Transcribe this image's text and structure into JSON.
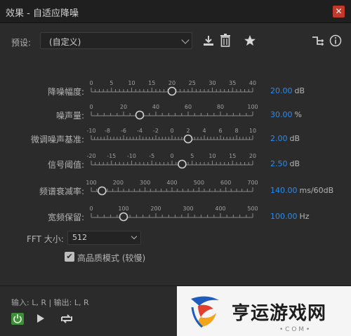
{
  "window": {
    "title": "效果 - 自适应降噪",
    "close_glyph": "✕"
  },
  "toolbar": {
    "preset_label": "预设:",
    "preset_value": "(自定义)",
    "icons": [
      "download-icon",
      "trash-icon",
      "star-icon",
      "routing-icon",
      "info-icon"
    ]
  },
  "sliders": [
    {
      "label": "降噪幅度:",
      "ticks": [
        "0",
        "5",
        "10",
        "15",
        "20",
        "25",
        "30",
        "35",
        "40"
      ],
      "min": 0,
      "max": 40,
      "value": 20,
      "value_text": "20.00",
      "unit": "dB"
    },
    {
      "label": "噪声量:",
      "ticks": [
        "0",
        "20",
        "40",
        "60",
        "80",
        "100"
      ],
      "min": 0,
      "max": 100,
      "value": 30,
      "value_text": "30.00",
      "unit": "%"
    },
    {
      "label": "微调噪声基准:",
      "ticks": [
        "-10",
        "-8",
        "-6",
        "-4",
        "-2",
        "0",
        "2",
        "4",
        "6",
        "8",
        "10"
      ],
      "min": -10,
      "max": 10,
      "value": 2,
      "value_text": "2.00",
      "unit": "dB"
    },
    {
      "label": "信号阈值:",
      "ticks": [
        "-20",
        "-15",
        "-10",
        "-5",
        "0",
        "5",
        "10",
        "15",
        "20"
      ],
      "min": -20,
      "max": 20,
      "value": 2.5,
      "value_text": "2.50",
      "unit": "dB"
    },
    {
      "label": "频谱衰减率:",
      "ticks": [
        "100",
        "200",
        "300",
        "400",
        "500",
        "600",
        "700"
      ],
      "min": 100,
      "max": 700,
      "value": 140,
      "value_text": "140.00",
      "unit": "ms/60dB"
    },
    {
      "label": "宽频保留:",
      "ticks": [
        "0",
        "100",
        "200",
        "300",
        "400",
        "500"
      ],
      "min": 0,
      "max": 500,
      "value": 100,
      "value_text": "100.00",
      "unit": "Hz"
    }
  ],
  "fft": {
    "label": "FFT 大小:",
    "value": "512"
  },
  "high_quality": {
    "label": "高品质模式 (较慢)",
    "checked": true
  },
  "io": {
    "text": "输入: L, R | 输出: L, R"
  },
  "transport": {
    "icons": [
      "power-icon",
      "play-icon",
      "loop-icon"
    ]
  },
  "watermark": {
    "text": "亨运游戏网",
    "dots": "• C O M •"
  },
  "colors": {
    "accent": "#2d8ceb",
    "power": "#3f8f3a",
    "close": "#c0392b"
  }
}
